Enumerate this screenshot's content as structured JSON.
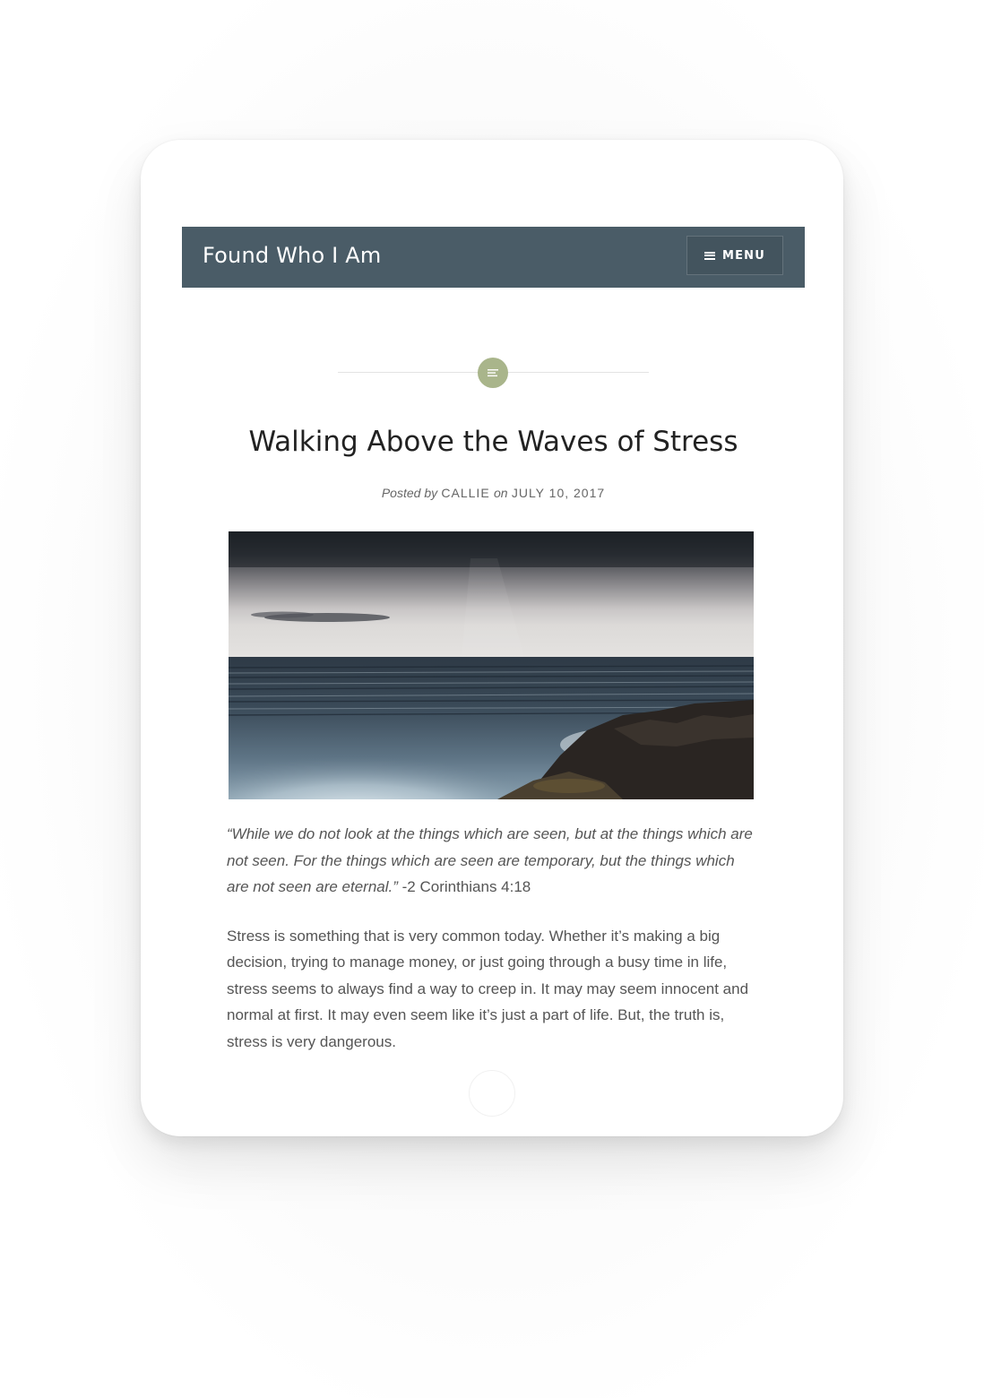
{
  "site": {
    "title": "Found Who I Am",
    "menu_label": "MENU"
  },
  "post": {
    "title": "Walking Above the Waves of Stress",
    "meta": {
      "posted_by_label": "Posted by",
      "author": "CALLIE",
      "on_label": "on",
      "date": "JULY 10, 2017"
    },
    "format_icon": "text-format-icon",
    "hero_image": "stormy-ocean-waves-rocks",
    "quote_text": "“While we do not look at the things which are seen, but at the things which are not seen. For the things which are seen are temporary, but the things which are not seen are eternal.”",
    "quote_reference": " -2 Corinthians 4:18",
    "paragraph": "Stress is something that is very common today. Whether it’s making a big decision, trying to manage money, or just going through a busy time in life, stress seems to always find a way to creep in. It may may seem innocent and normal at first. It may even seem like it’s just a part of life. But, the truth is, stress is very dangerous."
  },
  "colors": {
    "header_bg": "#4a5c67",
    "badge": "#a9b58b",
    "body_text": "#555555"
  }
}
